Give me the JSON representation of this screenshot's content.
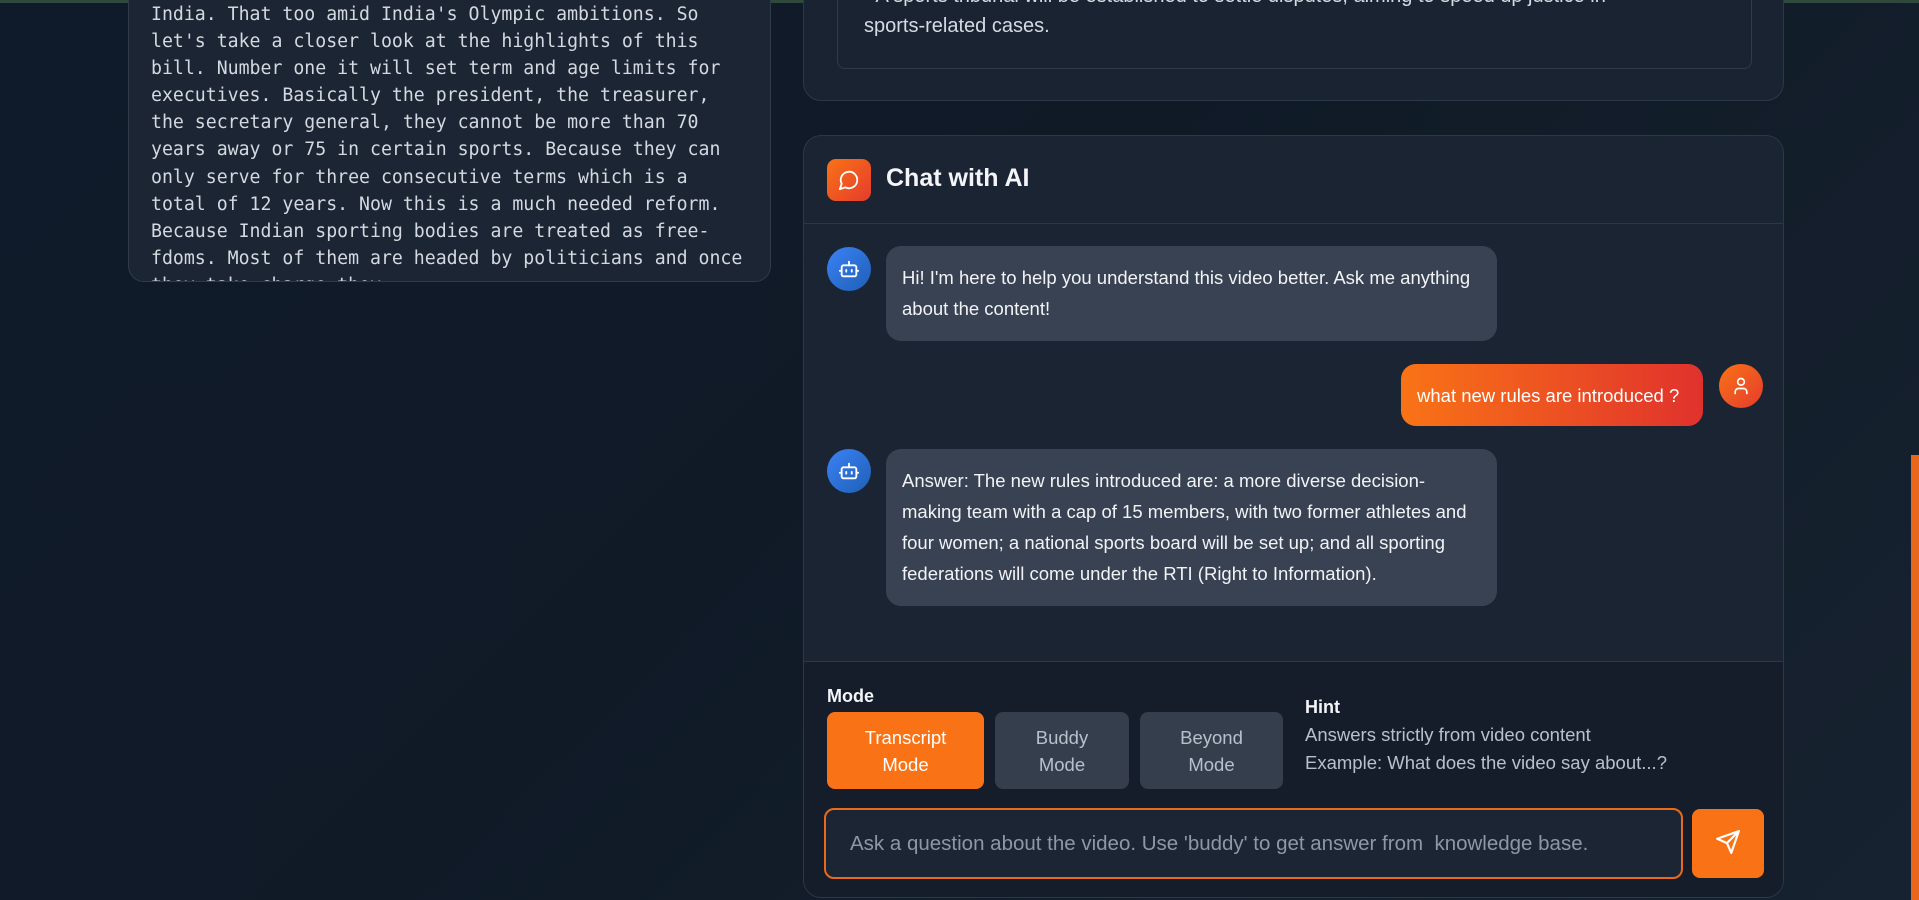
{
  "transcript": {
    "text": "India. That too amid India's Olympic ambitions. So let's take a closer look at the highlights of this bill. Number one it will set term and age limits for executives. Basically the president, the treasurer, the secretary general, they cannot be more than 70 years away or 75 in certain sports. Because they can only serve for three consecutive terms which is a total of 12 years. Now this is a much needed reform. Because Indian sporting bodies are treated as free-fdoms. Most of them are headed by politicians and once they take charge they"
  },
  "summary": {
    "line_partial": "• A sports tribunal will be established to settle disputes, aiming to speed up justice in",
    "line_2": "sports-related cases."
  },
  "chat": {
    "title": "Chat with AI",
    "messages": [
      {
        "role": "bot",
        "text": "Hi! I'm here to help you understand this video better. Ask me anything about the content!"
      },
      {
        "role": "user",
        "text": "what new rules are introduced ?"
      },
      {
        "role": "bot",
        "text": "Answer: The new rules introduced are: a more diverse decision-making team with a cap of 15 members, with two former athletes and four women; a national sports board will be set up; and all sporting federations will come under the RTI (Right to Information)."
      }
    ]
  },
  "mode": {
    "label": "Mode",
    "options": [
      {
        "line1": "Transcript",
        "line2": "Mode",
        "active": true
      },
      {
        "line1": "Buddy",
        "line2": "Mode",
        "active": false
      },
      {
        "line1": "Beyond",
        "line2": "Mode",
        "active": false
      }
    ],
    "hint_label": "Hint",
    "hint_line1": "Answers strictly from video content",
    "hint_line2": "Example: What does the video say about...?"
  },
  "input": {
    "value": "",
    "placeholder": "Ask a question about the video. Use 'buddy' to get answer from  knowledge base."
  },
  "colors": {
    "accent": "#f97316",
    "bot_avatar": "#3b82f6",
    "background": "#111b28"
  },
  "icons": {
    "chat_logo": "message-circle-icon",
    "bot": "bot-icon",
    "user": "user-icon",
    "send": "send-icon"
  }
}
